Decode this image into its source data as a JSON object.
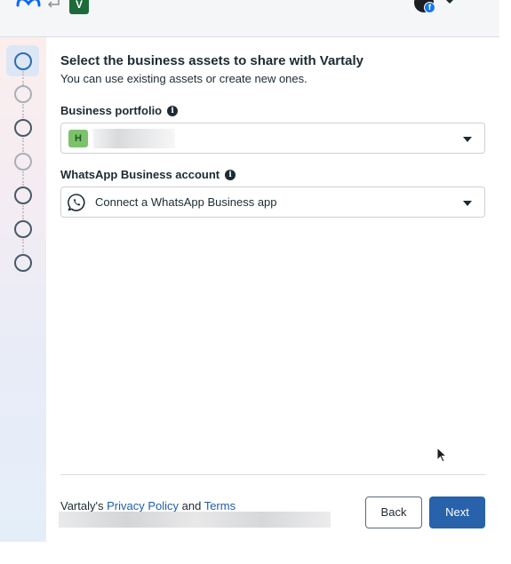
{
  "header": {
    "app_badge_letter": "V",
    "brand_icon": "meta-logo",
    "swap_icon": "arrows-swap-icon",
    "account_icon": "facebook-icon",
    "account_badge_letter": "f"
  },
  "stepper": {
    "steps": [
      {
        "state": "active"
      },
      {
        "state": "upcoming"
      },
      {
        "state": "upcoming"
      },
      {
        "state": "upcoming"
      },
      {
        "state": "upcoming"
      },
      {
        "state": "upcoming"
      },
      {
        "state": "upcoming"
      }
    ]
  },
  "main": {
    "title": "Select the business assets to share with Vartaly",
    "subtitle": "You can use existing assets or create new ones.",
    "business_portfolio": {
      "label": "Business portfolio",
      "badge_letter": "H",
      "value": ""
    },
    "whatsapp_account": {
      "label": "WhatsApp Business account",
      "value": "Connect a WhatsApp Business app"
    }
  },
  "footer": {
    "prefix": "Vartaly's ",
    "privacy_link": "Privacy Policy",
    "and_text": " and ",
    "terms_link": "Terms",
    "back_label": "Back",
    "next_label": "Next"
  },
  "colors": {
    "primary": "#2762ab",
    "link": "#1d5ea8",
    "whatsapp_badge": "#7cc26b",
    "app_badge": "#1e6b3a"
  }
}
